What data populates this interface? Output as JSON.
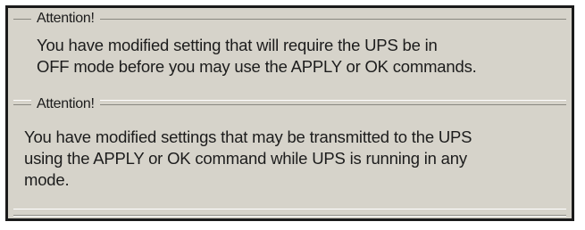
{
  "notices": [
    {
      "legend": "Attention!",
      "message": "You have modified setting that will require the UPS be in\nOFF mode before you may use the APPLY or OK commands."
    },
    {
      "legend": "Attention!",
      "message": "You have modified settings that may be transmitted to the UPS\nusing the APPLY or OK command while UPS is running in any\nmode."
    }
  ]
}
